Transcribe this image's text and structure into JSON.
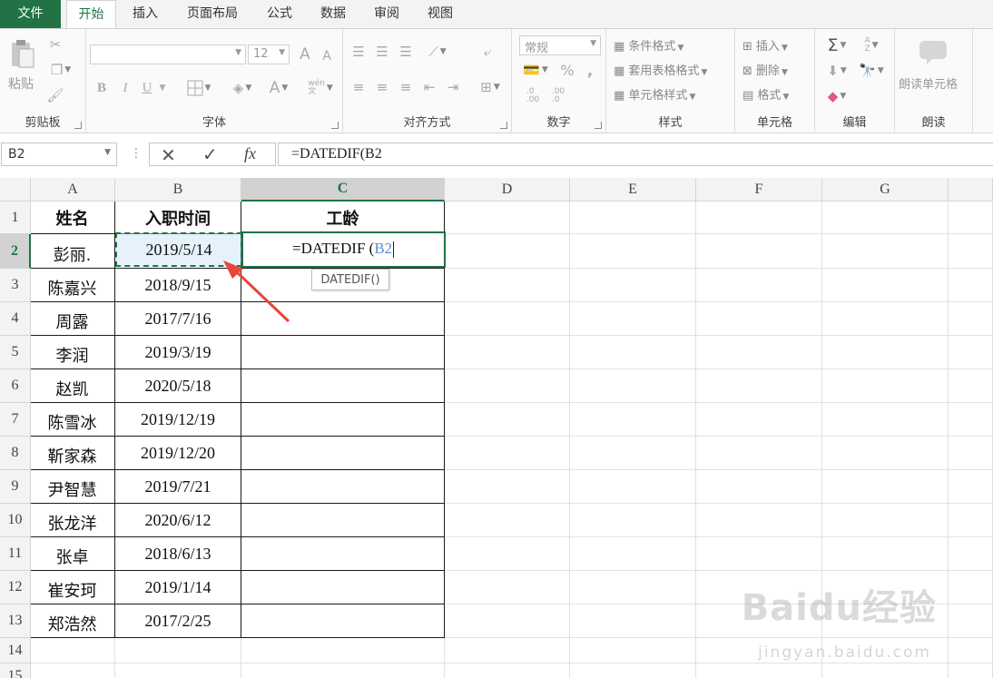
{
  "menu": {
    "tabs": [
      {
        "label": "文件"
      },
      {
        "label": "开始"
      },
      {
        "label": "插入"
      },
      {
        "label": "页面布局"
      },
      {
        "label": "公式"
      },
      {
        "label": "数据"
      },
      {
        "label": "审阅"
      },
      {
        "label": "视图"
      }
    ],
    "active_tab": "开始"
  },
  "ribbon": {
    "clipboard": {
      "label": "剪贴板",
      "paste": "粘贴"
    },
    "font": {
      "label": "字体",
      "size": "12",
      "bold": "B",
      "italic": "I",
      "underline": "U",
      "grow": "A",
      "shrink": "A",
      "font_color": "A",
      "wen": "wén\n文"
    },
    "alignment": {
      "label": "对齐方式"
    },
    "number": {
      "label": "数字",
      "format": "常规",
      "percent": "%",
      "comma": ",",
      "inc_dec": ".0\n.00",
      "dec_dec": ".00\n.0"
    },
    "styles": {
      "label": "样式",
      "conditional": "条件格式",
      "table_format": "套用表格格式",
      "cell_style": "单元格样式"
    },
    "cells": {
      "label": "单元格",
      "insert": "插入",
      "delete": "删除",
      "format": "格式"
    },
    "editing": {
      "label": "编辑",
      "sum": "Σ",
      "sort": "A\nZ"
    },
    "read": {
      "label": "朗读",
      "read_cell": "朗读单元格"
    }
  },
  "formula_bar": {
    "name_box": "B2",
    "cancel": "✕",
    "enter": "✓",
    "fx": "fx",
    "formula": "=DATEDIF(B2"
  },
  "grid": {
    "columns": [
      "A",
      "B",
      "C",
      "D",
      "E",
      "F",
      "G"
    ],
    "selected_column": "C",
    "rows": [
      "1",
      "2",
      "3",
      "4",
      "5",
      "6",
      "7",
      "8",
      "9",
      "10",
      "11",
      "12",
      "13",
      "14",
      "15"
    ],
    "selected_row": "2",
    "headers": {
      "name": "姓名",
      "hire_date": "入职时间",
      "seniority": "工龄"
    },
    "records": [
      {
        "name": "彭丽.",
        "date": "2019/5/14"
      },
      {
        "name": "陈嘉兴",
        "date": "2018/9/15"
      },
      {
        "name": "周露",
        "date": "2017/7/16"
      },
      {
        "name": "李润",
        "date": "2019/3/19"
      },
      {
        "name": "赵凯",
        "date": "2020/5/18"
      },
      {
        "name": "陈雪冰",
        "date": "2019/12/19"
      },
      {
        "name": "靳家森",
        "date": "2019/12/20"
      },
      {
        "name": "尹智慧",
        "date": "2019/7/21"
      },
      {
        "name": "张龙洋",
        "date": "2020/6/12"
      },
      {
        "name": "张卓",
        "date": "2018/6/13"
      },
      {
        "name": "崔安珂",
        "date": "2019/1/14"
      },
      {
        "name": "郑浩然",
        "date": "2017/2/25"
      }
    ],
    "editing_cell": {
      "text_prefix": "=DATEDIF (",
      "ref": "B2",
      "tooltip": "DATEDIF()"
    }
  },
  "watermark": {
    "logo": "Baidu经验",
    "url": "jingyan.baidu.com"
  },
  "colors": {
    "accent": "#217346",
    "annotation_arrow": "#e8453c",
    "ref_blue": "#5b8fd6"
  }
}
